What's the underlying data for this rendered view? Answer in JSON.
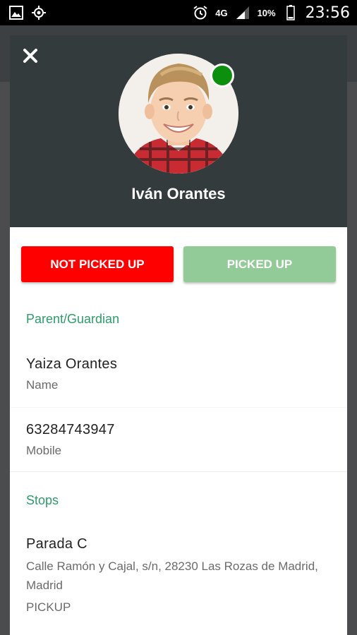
{
  "status_bar": {
    "network": "4G",
    "battery": "10%",
    "time": "23:56"
  },
  "dialog": {
    "child_name": "Iván Orantes",
    "online": true,
    "buttons": {
      "not_picked_up": "NOT PICKED UP",
      "picked_up": "PICKED UP"
    },
    "guardian_section": {
      "label": "Parent/Guardian",
      "name_value": "Yaiza Orantes",
      "name_label": "Name",
      "mobile_value": "63284743947",
      "mobile_label": "Mobile"
    },
    "stops_section": {
      "label": "Stops",
      "stop_name": "Parada C",
      "stop_address": "Calle Ramón y Cajal, s/n, 28230 Las Rozas de Madrid, Madrid",
      "stop_type": "PICKUP"
    }
  },
  "colors": {
    "header_bg": "#343b3d",
    "not_picked_up": "#ff0000",
    "picked_up": "#93cb98",
    "section_label": "#2e9c6a",
    "online": "#0c8f0c"
  }
}
